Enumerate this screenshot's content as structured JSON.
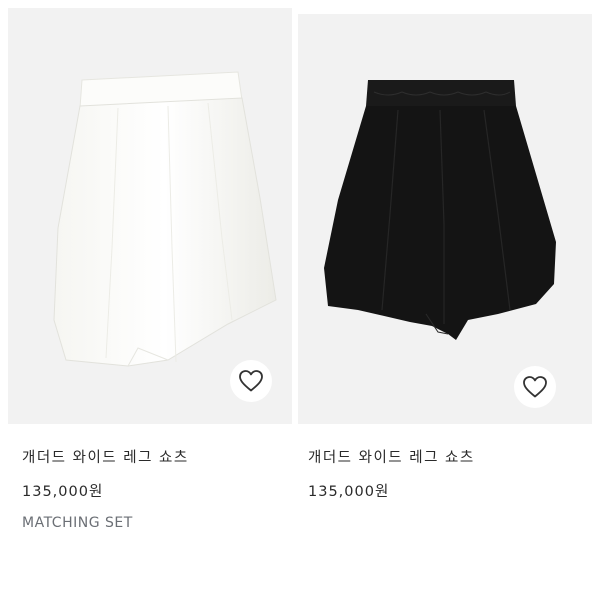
{
  "products": [
    {
      "name": "개더드 와이드 레그 쇼츠",
      "price": "135,000원",
      "tag": "MATCHING SET",
      "color": "#fbfbf8",
      "image_alt": "white gathered wide leg shorts",
      "wishlist_icon": "heart-outline-icon"
    },
    {
      "name": "개더드 와이드 레그 쇼츠",
      "price": "135,000원",
      "color": "#141414",
      "image_alt": "black gathered wide leg shorts",
      "wishlist_icon": "heart-outline-icon"
    }
  ],
  "colors": {
    "image_background": "#f2f2f2",
    "text": "#2a2a2a",
    "tag_text": "#6b6f75"
  }
}
